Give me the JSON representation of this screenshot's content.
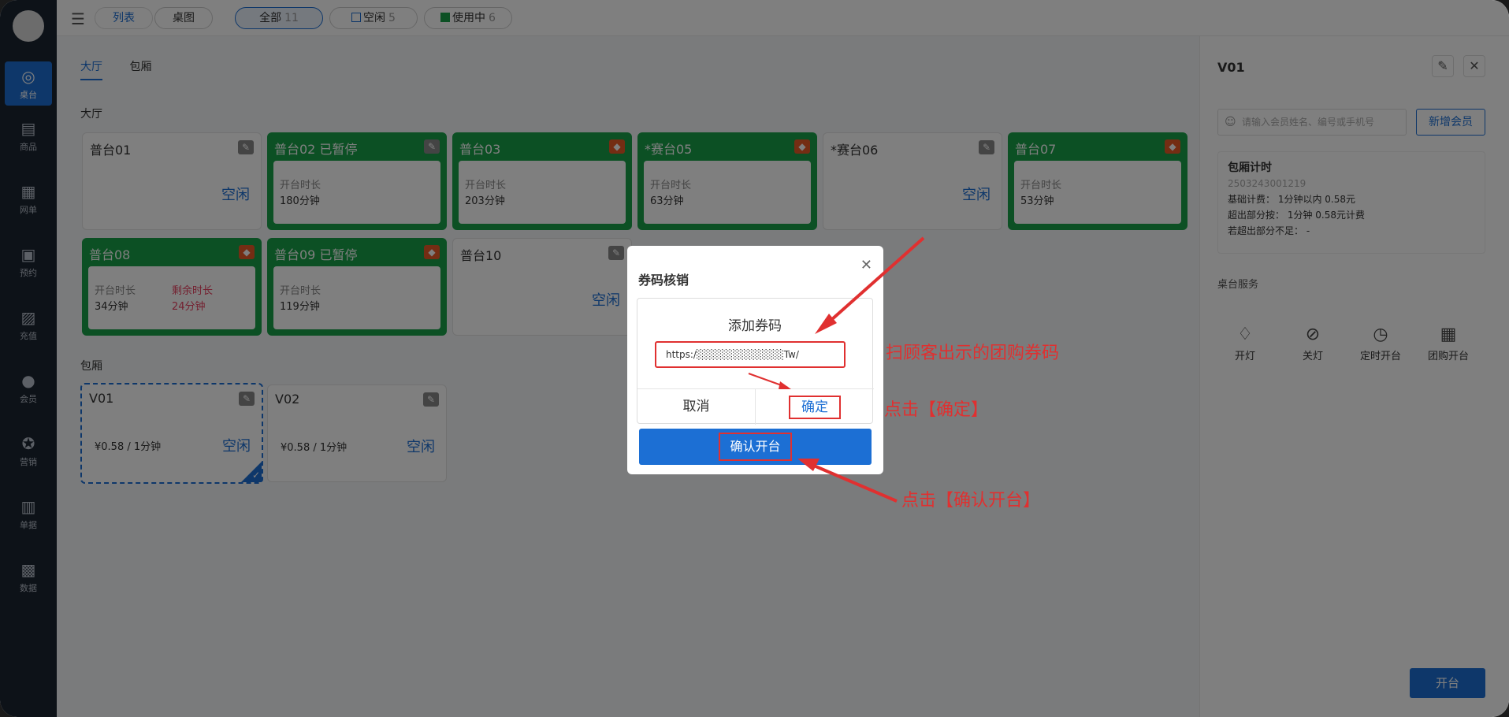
{
  "topbar": {
    "view_list": "列表",
    "view_desk": "桌图",
    "filter_all": {
      "label": "全部",
      "count": "11"
    },
    "filter_idle": {
      "label": "空闲",
      "count": "5"
    },
    "filter_busy": {
      "label": "使用中",
      "count": "6"
    }
  },
  "sidebar": [
    {
      "label": "桌台",
      "icon": "table-icon"
    },
    {
      "label": "商品",
      "icon": "product-icon"
    },
    {
      "label": "网单",
      "icon": "order-icon"
    },
    {
      "label": "预约",
      "icon": "calendar-icon"
    },
    {
      "label": "充值",
      "icon": "wallet-icon"
    },
    {
      "label": "会员",
      "icon": "user-icon"
    },
    {
      "label": "营销",
      "icon": "star-icon"
    },
    {
      "label": "单据",
      "icon": "document-icon"
    },
    {
      "label": "数据",
      "icon": "chart-icon"
    }
  ],
  "tabs": {
    "hall": "大厅",
    "room": "包厢"
  },
  "section": {
    "hall": "大厅",
    "room": "包厢"
  },
  "labels": {
    "duration": "开台时长",
    "remaining": "剩余时长",
    "idle": "空闲"
  },
  "tables": {
    "t01": {
      "name": "普台01"
    },
    "t02": {
      "name": "普台02  已暂停",
      "duration": "180分钟"
    },
    "t03": {
      "name": "普台03",
      "duration": "203分钟"
    },
    "t05": {
      "name": "*赛台05",
      "duration": "63分钟"
    },
    "t06": {
      "name": "*赛台06"
    },
    "t07": {
      "name": "普台07",
      "duration": "53分钟"
    },
    "t08": {
      "name": "普台08",
      "duration": "34分钟",
      "remaining": "24分钟"
    },
    "t09": {
      "name": "普台09  已暂停",
      "duration": "119分钟"
    },
    "t10": {
      "name": "普台10"
    },
    "v01": {
      "name": "V01",
      "price": "¥0.58 / 1分钟"
    },
    "v02": {
      "name": "V02",
      "price": "¥0.58 / 1分钟"
    }
  },
  "panel": {
    "title": "V01",
    "search_placeholder": "请输入会员姓名、编号或手机号",
    "add_member": "新增会员",
    "bill_title": "包厢计时",
    "bill_no": "2503243001219",
    "bill_base": "基础计费：  1分钟以内 0.58元",
    "bill_extra": "超出部分按：  1分钟 0.58元计费",
    "bill_short": "若超出部分不足：  -",
    "services_title": "桌台服务",
    "services": [
      "开灯",
      "关灯",
      "定时开台",
      "团购开台"
    ],
    "open_button": "开台"
  },
  "dialog": {
    "title": "券码核销",
    "sub_title": "添加券码",
    "code_value": "https:/░░░░░░░░░░░░Tw/",
    "cancel": "取消",
    "ok": "确定",
    "confirm_open": "确认开台"
  },
  "annotations": {
    "scan": "扫顾客出示的团购券码",
    "click_ok": "点击【确定】",
    "click_confirm": "点击【确认开台】"
  },
  "colors": {
    "accent": "#1c6fd4",
    "busy": "#18a048",
    "annotation": "#e03030"
  }
}
